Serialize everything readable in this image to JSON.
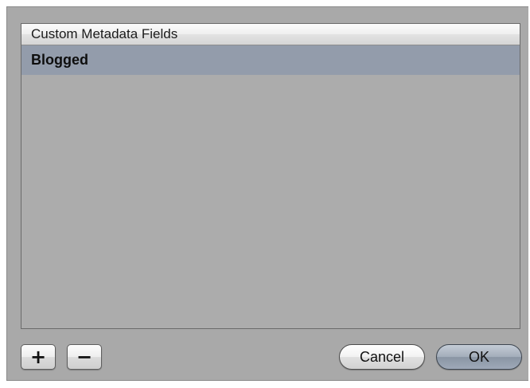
{
  "dialog": {
    "table": {
      "header": "Custom Metadata Fields",
      "rows": [
        {
          "label": "Blogged",
          "selected": true
        }
      ]
    },
    "buttons": {
      "add_symbol": "+",
      "remove_symbol": "−",
      "cancel_label": "Cancel",
      "ok_label": "OK"
    }
  },
  "colors": {
    "dialog_background": "#a9a9a9",
    "selected_row": "#939cab",
    "default_button": "#9ea9b8"
  }
}
